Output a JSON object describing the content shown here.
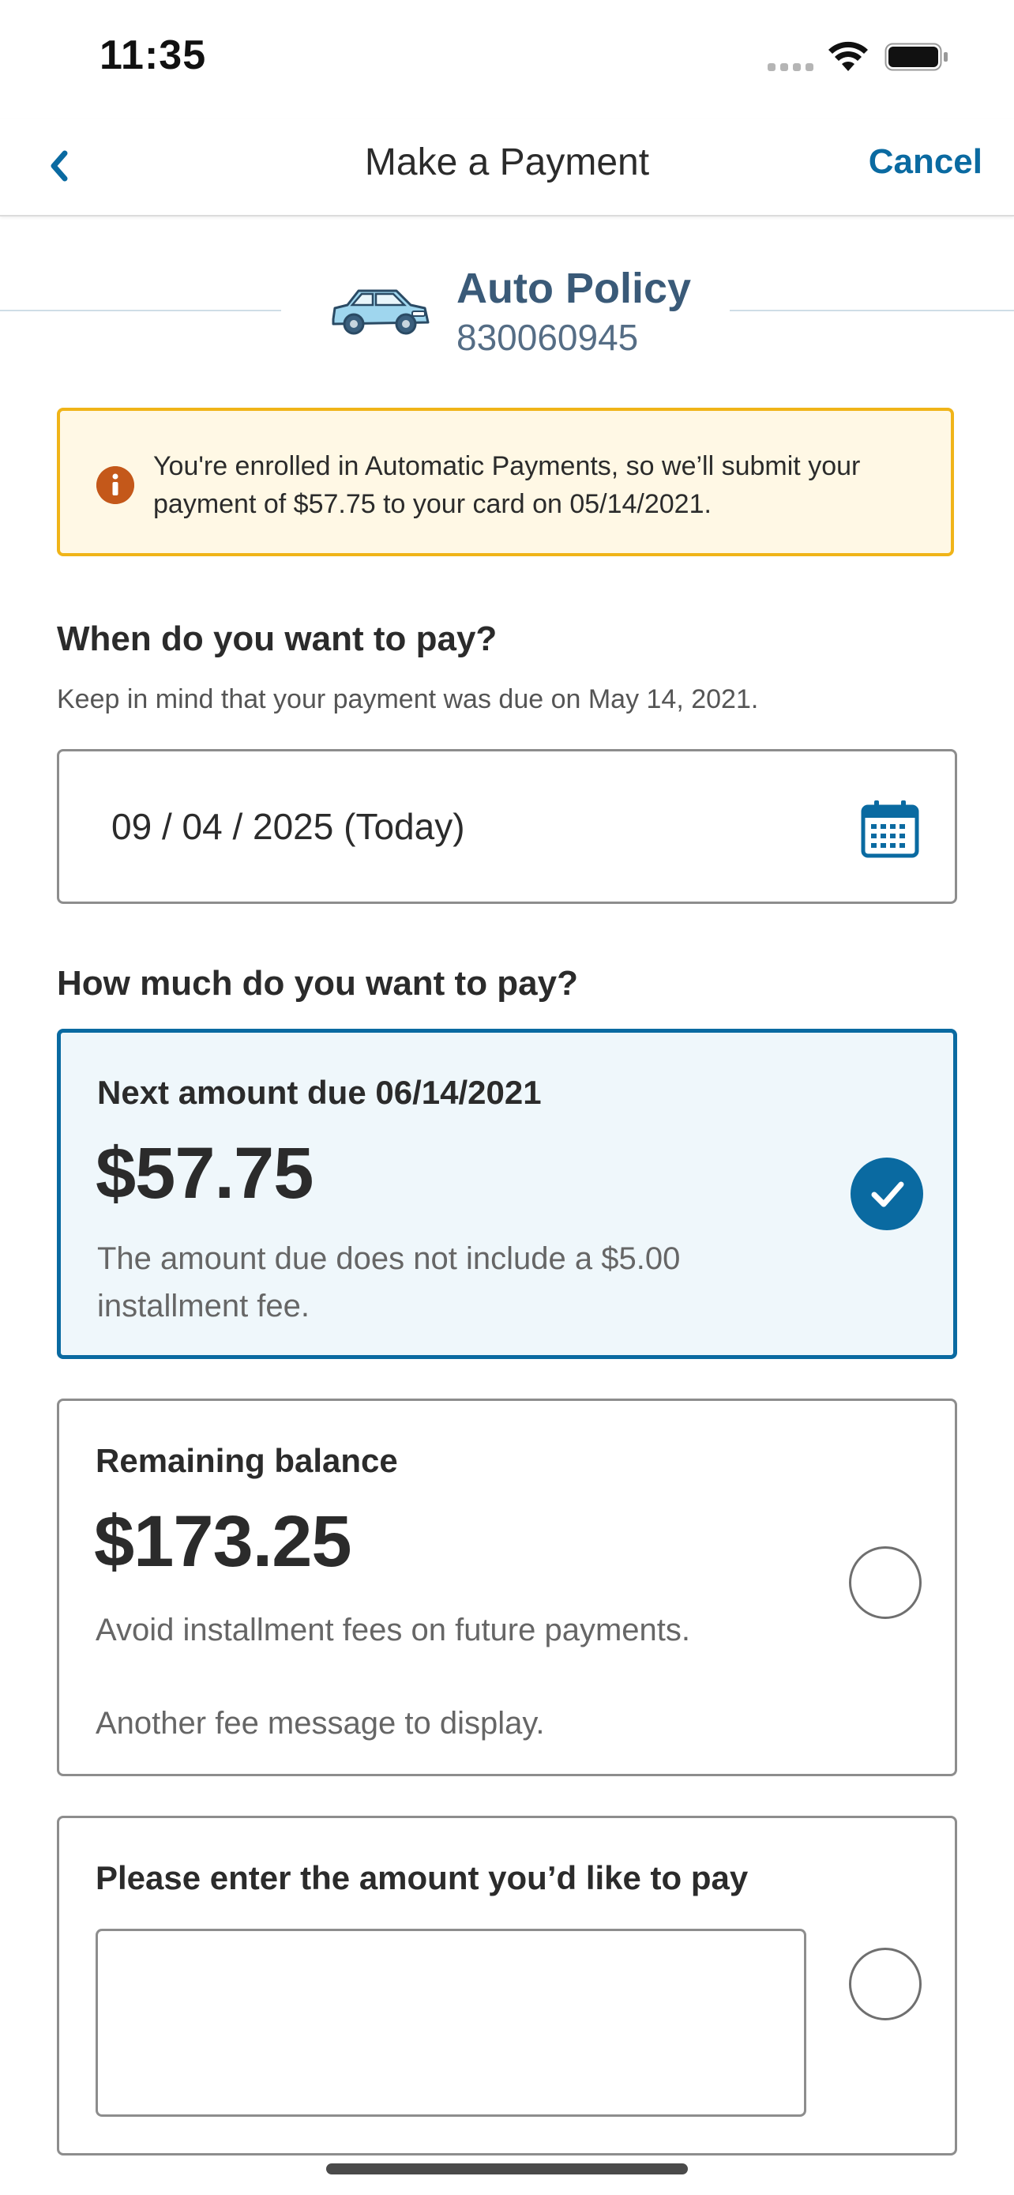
{
  "status_bar": {
    "time": "11:35"
  },
  "navbar": {
    "title": "Make a Payment",
    "cancel_label": "Cancel"
  },
  "policy": {
    "name": "Auto Policy",
    "number": "830060945"
  },
  "notice": {
    "text": "You're enrolled in Automatic Payments, so we’ll submit your payment of $57.75 to your card on 05/14/2021."
  },
  "when": {
    "heading": "When do you want to pay?",
    "subtext": "Keep in mind that your payment was due on May 14, 2021.",
    "date_value": "09 / 04 / 2025 (Today)"
  },
  "how_much": {
    "heading": "How much do you want to pay?",
    "options": [
      {
        "label": "Next amount due 06/14/2021",
        "amount": "$57.75",
        "note": "The amount due does not include a $5.00 installment fee.",
        "selected": true
      },
      {
        "label": "Remaining balance",
        "amount": "$173.25",
        "note": "Avoid installment fees on future payments.",
        "note2": "Another fee message to display.",
        "selected": false
      },
      {
        "label": "Please enter the amount you’d like to pay",
        "input_value": "",
        "selected": false
      }
    ]
  },
  "colors": {
    "accent": "#0a6aa1",
    "notice_border": "#f0b418",
    "notice_bg": "#fff8e5",
    "notice_icon": "#c4581a",
    "selected_bg": "#eff7fb"
  },
  "icons": [
    "chevron-left-icon",
    "car-icon",
    "info-icon",
    "calendar-icon",
    "checkmark-icon",
    "wifi-icon",
    "battery-icon",
    "signal-icon"
  ]
}
